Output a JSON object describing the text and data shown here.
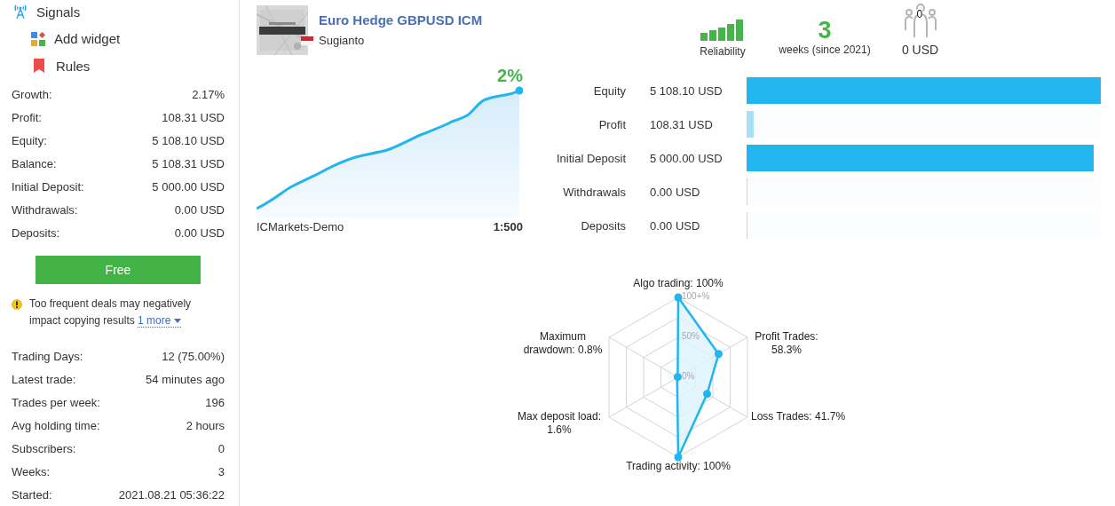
{
  "sidebar": {
    "nav": [
      {
        "label": "Signals",
        "kind": "signals"
      },
      {
        "label": "Add widget",
        "kind": "widget"
      },
      {
        "label": "Rules",
        "kind": "rules"
      }
    ],
    "stats": [
      {
        "label": "Growth:",
        "value": "2.17%"
      },
      {
        "label": "Profit:",
        "value": "108.31 USD"
      },
      {
        "label": "Equity:",
        "value": "5 108.10 USD"
      },
      {
        "label": "Balance:",
        "value": "5 108.31 USD"
      },
      {
        "label": "Initial Deposit:",
        "value": "5 000.00 USD"
      },
      {
        "label": "Withdrawals:",
        "value": "0.00 USD"
      },
      {
        "label": "Deposits:",
        "value": "0.00 USD"
      }
    ],
    "subscribe_button": "Free",
    "warning": {
      "text": "Too frequent deals may negatively impact copying results",
      "more_link": "1 more"
    },
    "trading_stats": [
      {
        "label": "Trading Days:",
        "value": "12 (75.00%)"
      },
      {
        "label": "Latest trade:",
        "value": "54 minutes ago"
      },
      {
        "label": "Trades per week:",
        "value": "196"
      },
      {
        "label": "Avg holding time:",
        "value": "2 hours"
      },
      {
        "label": "Subscribers:",
        "value": "0"
      },
      {
        "label": "Weeks:",
        "value": "3"
      },
      {
        "label": "Started:",
        "value": "2021.08.21 05:36:22"
      }
    ]
  },
  "signal": {
    "title": "Euro Hedge GBPUSD ICM",
    "author": "Sugianto"
  },
  "summary": {
    "reliability_label": "Reliability",
    "weeks": "3",
    "weeks_label": "weeks (since 2021)",
    "subscribers_count": "0",
    "subscribers_funds": "0 USD"
  },
  "growth": {
    "value": "2%",
    "server": "ICMarkets-Demo",
    "leverage": "1:500"
  },
  "balance": [
    {
      "label": "Equity",
      "value": "5 108.10 USD",
      "level": 1.0,
      "color": "#22b5ee"
    },
    {
      "label": "Profit",
      "value": "108.31 USD",
      "level": 0.021,
      "color": "#a6e1f8"
    },
    {
      "label": "Initial Deposit",
      "value": "5 000.00 USD",
      "level": 0.979,
      "color": "#22b5ee"
    },
    {
      "label": "Withdrawals",
      "value": "0.00 USD",
      "level": 0,
      "color": "#a6e1f8"
    },
    {
      "label": "Deposits",
      "value": "0.00 USD",
      "level": 0,
      "color": "#a6e1f8"
    }
  ],
  "radar": {
    "ticks": [
      "100+%",
      "50%",
      "0%"
    ],
    "axes": [
      {
        "label": "Algo trading: 100%"
      },
      {
        "label": "Maximum drawdown: 0.8%"
      },
      {
        "label": "Profit Trades: 58.3%"
      },
      {
        "label": "Max deposit load: 1.6%"
      },
      {
        "label": "Loss Trades: 41.7%"
      },
      {
        "label": "Trading activity: 100%"
      }
    ]
  }
}
